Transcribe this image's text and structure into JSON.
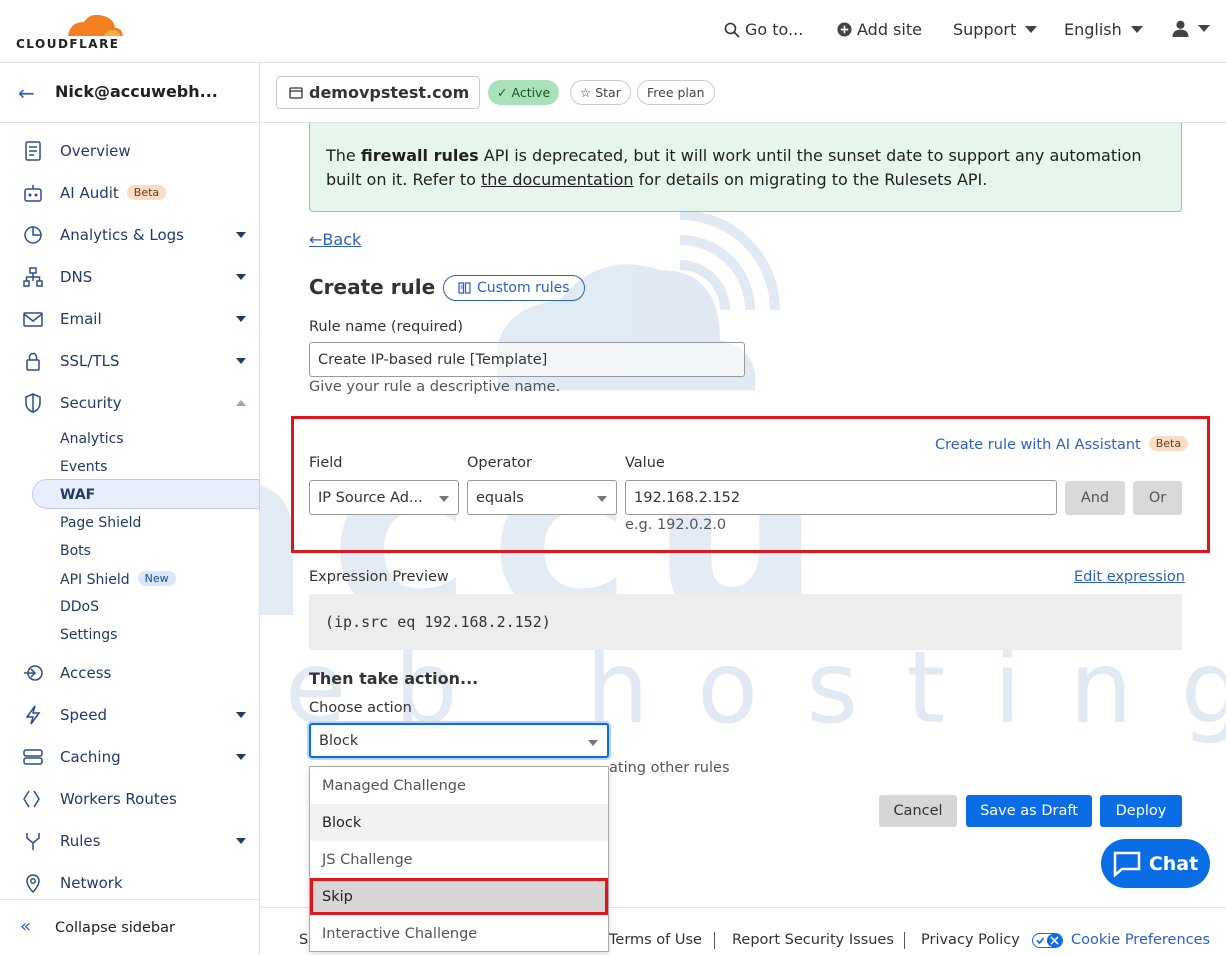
{
  "header": {
    "logo_text": "CLOUDFLARE",
    "goto_label": "Go to...",
    "add_site_label": "Add site",
    "support_label": "Support",
    "language_label": "English"
  },
  "sidebar": {
    "account_name": "Nick@accuwebh...",
    "items": [
      {
        "label": "Overview"
      },
      {
        "label": "AI Audit",
        "badge": "Beta"
      },
      {
        "label": "Analytics & Logs"
      },
      {
        "label": "DNS"
      },
      {
        "label": "Email"
      },
      {
        "label": "SSL/TLS"
      },
      {
        "label": "Security"
      },
      {
        "label": "Access"
      },
      {
        "label": "Speed"
      },
      {
        "label": "Caching"
      },
      {
        "label": "Workers Routes"
      },
      {
        "label": "Rules"
      },
      {
        "label": "Network"
      }
    ],
    "security_sub": [
      {
        "label": "Analytics"
      },
      {
        "label": "Events"
      },
      {
        "label": "WAF"
      },
      {
        "label": "Page Shield"
      },
      {
        "label": "Bots"
      },
      {
        "label": "API Shield",
        "badge": "New"
      },
      {
        "label": "DDoS"
      },
      {
        "label": "Settings"
      }
    ],
    "collapse_label": "Collapse sidebar"
  },
  "domain": {
    "name": "demovpstest.com",
    "status": "Active",
    "star_label": "Star",
    "plan": "Free plan"
  },
  "notice": {
    "prefix": "The ",
    "bold": "firewall rules",
    "middle": " API is deprecated, but it will work until the sunset date to support any automation built on it. Refer to ",
    "link": "the documentation",
    "suffix": " for details on migrating to the Rulesets API."
  },
  "form": {
    "back_label": "Back",
    "title": "Create rule",
    "custom_rules_label": "Custom rules",
    "rule_name_label": "Rule name (required)",
    "rule_name_value": "Create IP-based rule [Template]",
    "rule_name_hint": "Give your rule a descriptive name.",
    "ai_link": "Create rule with AI Assistant",
    "ai_badge": "Beta",
    "field_label": "Field",
    "field_value": "IP Source Ad...",
    "operator_label": "Operator",
    "operator_value": "equals",
    "value_label": "Value",
    "value_value": "192.168.2.152",
    "value_hint": "e.g. 192.0.2.0",
    "and_label": "And",
    "or_label": "Or",
    "expression_label": "Expression Preview",
    "edit_expression_label": "Edit expression",
    "expression": "(ip.src eq 192.168.2.152)",
    "then_title": "Then take action...",
    "choose_action_label": "Choose action",
    "action_value": "Block",
    "action_hint": "ating other rules",
    "cancel_label": "Cancel",
    "draft_label": "Save as Draft",
    "deploy_label": "Deploy",
    "action_options": [
      "Managed Challenge",
      "Block",
      "JS Challenge",
      "Skip",
      "Interactive Challenge"
    ]
  },
  "chat_label": "Chat",
  "footer": {
    "partial": "S",
    "links": [
      "Terms of Use",
      "Report Security Issues",
      "Privacy Policy",
      "Cookie Preferences"
    ]
  },
  "watermark": {
    "brand": "accu",
    "tagline": "web hosting"
  },
  "colors": {
    "accent": "#0b6de6",
    "highlight_box": "#e0161d",
    "notice_bg": "#e6f6ec"
  }
}
